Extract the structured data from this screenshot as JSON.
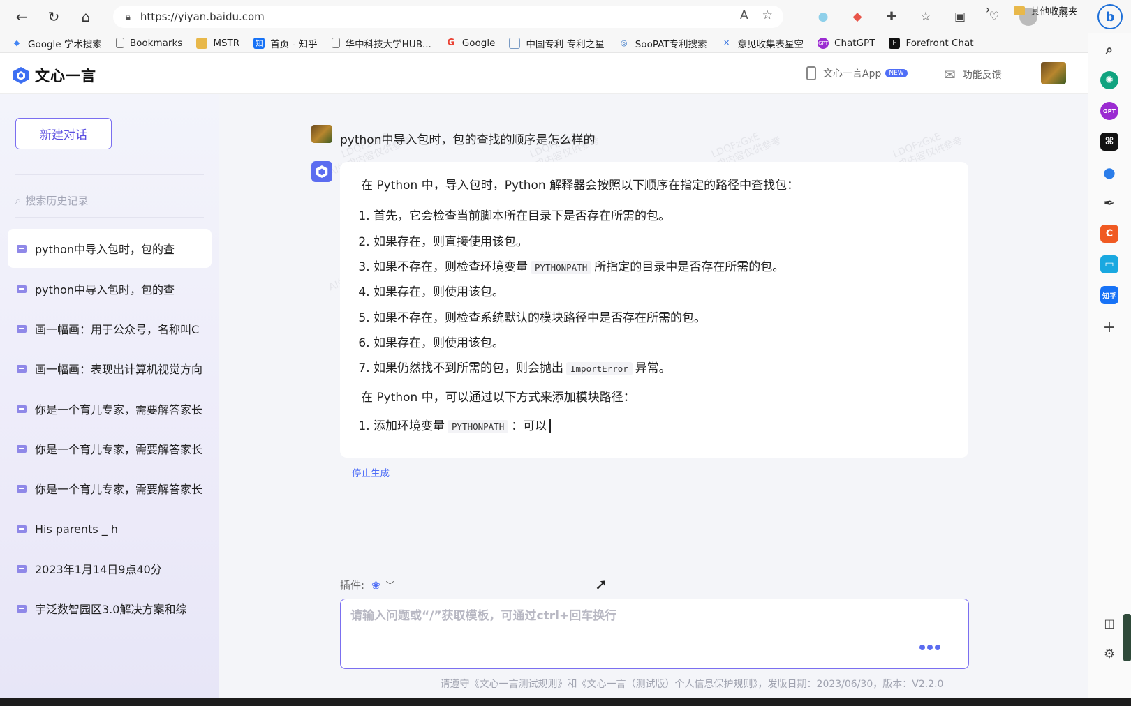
{
  "browser": {
    "url": "https://yiyan.baidu.com",
    "bookmarks": [
      {
        "label": "Google 学术搜索",
        "icon": "google-scholar-icon",
        "color": "#4285f4"
      },
      {
        "label": "Bookmarks",
        "icon": "file-icon",
        "color": "#888888"
      },
      {
        "label": "MSTR",
        "icon": "folder-icon",
        "color": "#e8b84a"
      },
      {
        "label": "首页 - 知乎",
        "icon": "zhihu-icon",
        "color": "#1772f6"
      },
      {
        "label": "华中科技大学HUB...",
        "icon": "file-icon",
        "color": "#888888"
      },
      {
        "label": "Google",
        "icon": "google-icon",
        "color": "#ea4335"
      },
      {
        "label": "中国专利 专利之星",
        "icon": "patent-icon",
        "color": "#7a9bc4"
      },
      {
        "label": "SooPAT专利搜索",
        "icon": "soopat-icon",
        "color": "#3b79c8"
      },
      {
        "label": "意见收集表星空",
        "icon": "star-icon",
        "color": "#2f6fe0"
      },
      {
        "label": "ChatGPT",
        "icon": "gpt-icon",
        "color": "#9b2bd1"
      },
      {
        "label": "Forefront Chat",
        "icon": "forefront-icon",
        "color": "#111111"
      }
    ],
    "other_bookmarks": "其他收藏夹"
  },
  "app": {
    "title": "文心一言",
    "app_link": "文心一言App",
    "new_badge": "NEW",
    "feedback": "功能反馈"
  },
  "sidebar": {
    "new_chat": "新建对话",
    "search_placeholder": "搜索历史记录",
    "history": [
      "python中导入包时，包的查",
      "python中导入包时，包的查",
      "画一幅画：用于公众号，名称叫C",
      "画一幅画：表现出计算机视觉方向",
      "你是一个育儿专家，需要解答家长",
      "你是一个育儿专家，需要解答家长",
      "你是一个育儿专家，需要解答家长",
      "His parents _ h",
      "2023年1月14日9点40分",
      "宇泛数智园区3.0解决方案和综"
    ]
  },
  "chat": {
    "question": "python中导入包时，包的查找的顺序是怎么样的",
    "answer_intro": "在 Python 中，导入包时，Python 解释器会按照以下顺序在指定的路径中查找包：",
    "steps": {
      "s1": "首先，它会检查当前脚本所在目录下是否存在所需的包。",
      "s2": "如果存在，则直接使用该包。",
      "s3a": "如果不存在，则检查环境变量",
      "s3code": "PYTHONPATH",
      "s3b": "所指定的目录中是否存在所需的包。",
      "s4": "如果存在，则使用该包。",
      "s5": "如果不存在，则检查系统默认的模块路径中是否存在所需的包。",
      "s6": "如果存在，则使用该包。",
      "s7a": "如果仍然找不到所需的包，则会抛出",
      "s7code": "ImportError",
      "s7b": "异常。"
    },
    "answer_sub": "在 Python 中，可以通过以下方式来添加模块路径：",
    "sub_step": {
      "a": "添加环境变量",
      "code": "PYTHONPATH",
      "b": "：可以"
    },
    "stop": "停止生成",
    "plugin_label": "插件:",
    "input_placeholder": "请输入问题或“/”获取模板，可通过ctrl+回车换行",
    "footer": "请遵守《文心一言测试规则》和《文心一言（测试版）个人信息保护规则》，发版日期：2023/06/30，版本：V2.2.0",
    "watermark_line1": "LDQFzGxE",
    "watermark_line2": "AI生成内容仅供参考"
  }
}
